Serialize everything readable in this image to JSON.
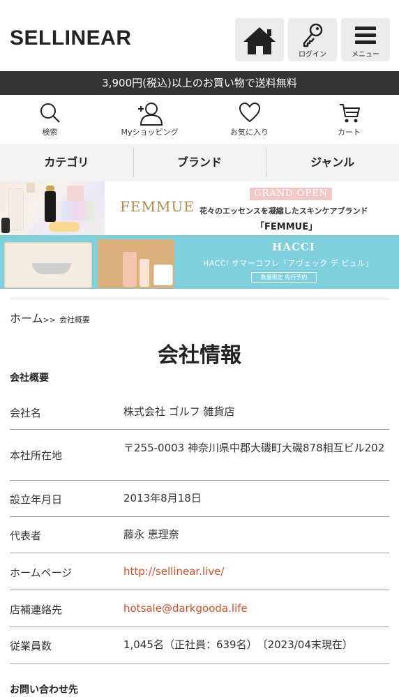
{
  "header": {
    "logo": "SELLINEAR",
    "login_label": "ログイン",
    "menu_label": "メニュー"
  },
  "notice": "3,900円(税込)以上のお買い物で送料無料",
  "icon_nav": [
    {
      "label": "検索",
      "icon": "search-icon"
    },
    {
      "label": "Myショッピング",
      "icon": "user-add-icon"
    },
    {
      "label": "お気に入り",
      "icon": "heart-icon"
    },
    {
      "label": "カート",
      "icon": "cart-icon"
    }
  ],
  "tabs": [
    "カテゴリ",
    "ブランド",
    "ジャンル"
  ],
  "promo1": {
    "brand": "FEMMUE",
    "badge": "GRAND OPEN",
    "line1": "花々のエッセンスを凝縮したスキンケアブランド",
    "line2": "「FEMMUE」"
  },
  "promo2": {
    "title": "HACCI",
    "line1": "HACCI サマーコフレ「アヴェック デ ビュル」",
    "tag": "数量限定 先行予約"
  },
  "breadcrumb": {
    "home": "ホーム",
    "sep": ">>",
    "current": "会社概要"
  },
  "page_title": "会社情報",
  "section_company": "会社概要",
  "company_rows": [
    {
      "key": "会社名",
      "value": "株式会社 ゴルフ 雑貨店"
    },
    {
      "key": "本社所在地",
      "value": "〒255-0003 神奈川県中郡大磯町大磯878相互ビル202"
    },
    {
      "key": "設立年月日",
      "value": "2013年8月18日"
    },
    {
      "key": "代表者",
      "value": "藤永 恵理奈"
    },
    {
      "key": "ホームページ",
      "value": "http://sellinear.live/"
    },
    {
      "key": "店補連絡先",
      "value": "hotsale@darkgooda.life"
    },
    {
      "key": "従業員数",
      "value": "1,045名（正社員：639名）　〔2023/04末現在）"
    }
  ],
  "section_contact": "お問い合わせ先",
  "colors": {
    "link": "#e04a1e",
    "notice_bg": "#333333",
    "tab_bg": "#f2f2f2"
  }
}
